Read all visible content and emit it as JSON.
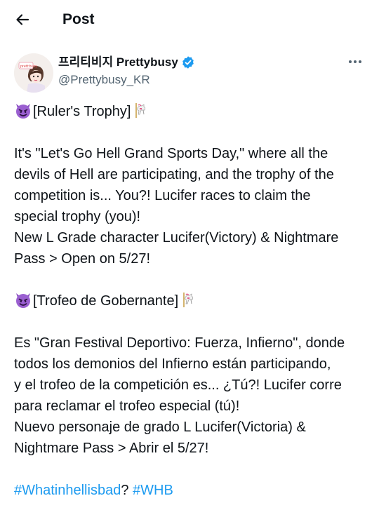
{
  "header": {
    "back_icon": "arrow-left-icon",
    "title": "Post"
  },
  "author": {
    "display_name": "프리티비지 Prettybusy",
    "handle": "@Prettybusy_KR",
    "verified_icon": "verified-badge-icon",
    "more_icon": "more-horizontal-icon",
    "avatar_text": "prett:busy"
  },
  "tweet": {
    "en_title": "[Ruler's Trophy]",
    "en_lines": [
      "It's \"Let's Go Hell Grand Sports Day,\" where all the",
      "devils of Hell are participating, and the trophy of the",
      "competition is... You?! Lucifer races to claim the",
      "special trophy (you)!",
      "New L Grade character Lucifer(Victory) & Nightmare",
      "Pass > Open on 5/27!"
    ],
    "es_title": "[Trofeo de Gobernante]",
    "es_lines": [
      "Es \"Gran Festival Deportivo: Fuerza, Infierno\", donde",
      "todos los demonios del Infierno están participando,",
      "y el trofeo de la competición es... ¿Tú?! Lucifer corre",
      "para reclamar el trofeo especial (tú)!",
      "Nuevo personaje de grado L Lucifer(Victoria) &",
      "Nightmare Pass > Abrir el 5/27!"
    ],
    "hashtag1": "#Whatinhellisbad",
    "hashtag_sep": "? ",
    "hashtag2": "#WHB",
    "emoji_devil": "smiling-imp-emoji",
    "emoji_carousel": "carousel-horse-emoji"
  },
  "colors": {
    "link": "#1d9bf0",
    "secondary_text": "#536471",
    "primary_text": "#0f1419",
    "verified": "#1d9bf0",
    "devil_purple": "#8a4fc1"
  }
}
